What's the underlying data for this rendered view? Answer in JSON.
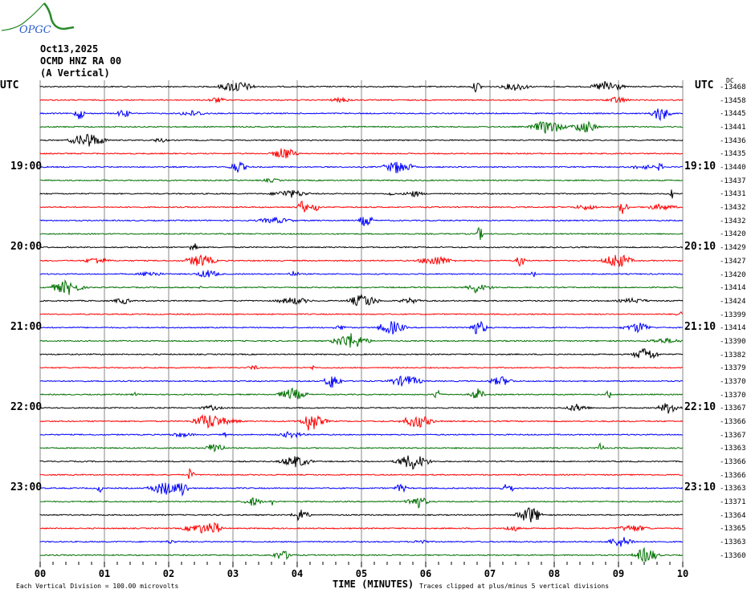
{
  "header": {
    "logo_text": "OPGC",
    "date": "Oct13,2025",
    "station": "OCMD HNZ RA 00",
    "component": "(A Vertical)"
  },
  "chart_data": {
    "type": "line",
    "title": "OCMD HNZ RA 00 helicorder",
    "xlabel": "TIME (MINUTES)",
    "xlim": [
      0,
      10
    ],
    "x_ticks": [
      "00",
      "01",
      "02",
      "03",
      "04",
      "05",
      "06",
      "07",
      "08",
      "09",
      "10"
    ],
    "left_axis_title": "UTC",
    "right_axis_title": "UTC",
    "dc_header": "DC",
    "left_time_labels": [
      {
        "row": 6,
        "label": "19:00"
      },
      {
        "row": 12,
        "label": "20:00"
      },
      {
        "row": 18,
        "label": "21:00"
      },
      {
        "row": 24,
        "label": "22:00"
      },
      {
        "row": 30,
        "label": "23:00"
      }
    ],
    "right_time_labels": [
      {
        "row": 6,
        "label": "19:10"
      },
      {
        "row": 12,
        "label": "20:10"
      },
      {
        "row": 18,
        "label": "21:10"
      },
      {
        "row": 24,
        "label": "22:10"
      },
      {
        "row": 30,
        "label": "23:10"
      }
    ],
    "trace_colors": [
      "#000000",
      "#ff0000",
      "#0000ff",
      "#007000"
    ],
    "dc_offsets": [
      -13468,
      -13458,
      -13445,
      -13441,
      -13436,
      -13435,
      -13440,
      -13437,
      -13431,
      -13432,
      -13432,
      -13420,
      -13429,
      -13427,
      -13420,
      -13414,
      -13424,
      -13399,
      -13414,
      -13390,
      -13382,
      -13379,
      -13370,
      -13370,
      -13367,
      -13366,
      -13367,
      -13363,
      -13366,
      -13366,
      -13363,
      -13371,
      -13364,
      -13365,
      -13363,
      -13360
    ],
    "vertical_division": "Each Vertical Division =  100.00 microvolts",
    "clip_note": "Traces clipped at plus/minus 5 vertical divisions"
  }
}
